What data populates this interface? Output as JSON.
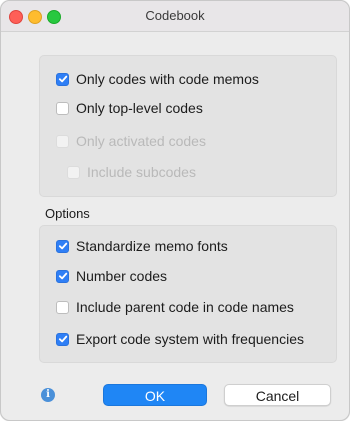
{
  "window": {
    "title": "Codebook"
  },
  "filters": {
    "only_codes_with_memos": {
      "label": "Only codes with code memos",
      "checked": true,
      "enabled": true
    },
    "only_top_level": {
      "label": "Only top-level codes",
      "checked": false,
      "enabled": true
    },
    "only_activated": {
      "label": "Only activated codes",
      "checked": false,
      "enabled": false
    },
    "include_subcodes": {
      "label": "Include subcodes",
      "checked": false,
      "enabled": false
    }
  },
  "options": {
    "section_label": "Options",
    "standardize_memo_fonts": {
      "label": "Standardize memo fonts",
      "checked": true
    },
    "number_codes": {
      "label": "Number codes",
      "checked": true
    },
    "include_parent_code": {
      "label": "Include parent code in code names",
      "checked": false
    },
    "export_with_frequencies": {
      "label": "Export code system with frequencies",
      "checked": true
    }
  },
  "footer": {
    "info_icon": "info-icon",
    "ok_label": "OK",
    "cancel_label": "Cancel"
  },
  "colors": {
    "accent": "#1f86f5",
    "checkbox_checked": "#2f7ff6",
    "window_bg": "#ececec",
    "group_bg": "#e3e3e3"
  }
}
